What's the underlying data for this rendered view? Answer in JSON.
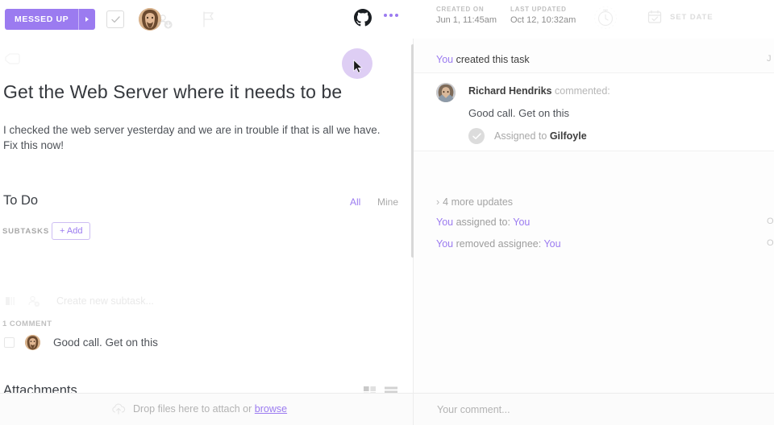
{
  "topbar": {
    "status_label": "MESSED UP",
    "status_color": "#9b7bf0",
    "caret_icon": "caret-right-icon",
    "complete_icon": "check-icon",
    "avatar_icon": "user-avatar",
    "add_assignee_icon": "add-person-icon",
    "priority_icon": "flag-icon",
    "integration_icon": "github-icon",
    "more_icon": "ellipsis-icon",
    "created_label": "CREATED ON",
    "created_value": "Jun 1, 11:45am",
    "updated_label": "LAST UPDATED",
    "updated_value": "Oct 12, 10:32am",
    "track_time_icon": "stopwatch-icon",
    "set_date_icon": "calendar-icon",
    "set_date_label": "SET DATE"
  },
  "left": {
    "tag_icon": "tag-icon",
    "title": "Get the Web Server where it needs to be",
    "description": "I checked the web server yesterday and we are in trouble if that is all we have. Fix this now!",
    "todo_heading": "To Do",
    "filter_all": "All",
    "filter_mine": "Mine",
    "subtasks_label": "SUBTASKS",
    "add_button": "+ Add",
    "subtask_placeholder": "Create new subtask...",
    "subtask_icon_1": "layers-icon",
    "subtask_icon_2": "assignee-icon",
    "comment_count": "1 COMMENT",
    "comment_text": "Good call. Get on this",
    "comment_avatar": "user-avatar",
    "attachments_heading": "Attachments",
    "grid_view_icon": "grid-view-icon",
    "list_view_icon": "list-view-icon"
  },
  "activity": {
    "created": {
      "actor": "You",
      "text": "created this task",
      "timestamp": "J"
    },
    "comment": {
      "author": "Richard Hendriks",
      "verb": "commented:",
      "body": "Good call. Get on this",
      "timestamp": "",
      "assign_icon": "check-circle-icon",
      "assign_prefix": "Assigned to",
      "assign_target": "Gilfoyle"
    },
    "more_updates": {
      "chevron": "›",
      "label": "4 more updates"
    },
    "entries": [
      {
        "actor": "You",
        "text": "assigned to:",
        "target": "You",
        "timestamp": "O"
      },
      {
        "actor": "You",
        "text": "removed assignee:",
        "target": "You",
        "timestamp": "O"
      }
    ]
  },
  "bottom": {
    "cloud_icon": "cloud-upload-icon",
    "drop_text": "Drop files here to attach or",
    "browse_link": "browse",
    "comment_placeholder": "Your comment..."
  }
}
